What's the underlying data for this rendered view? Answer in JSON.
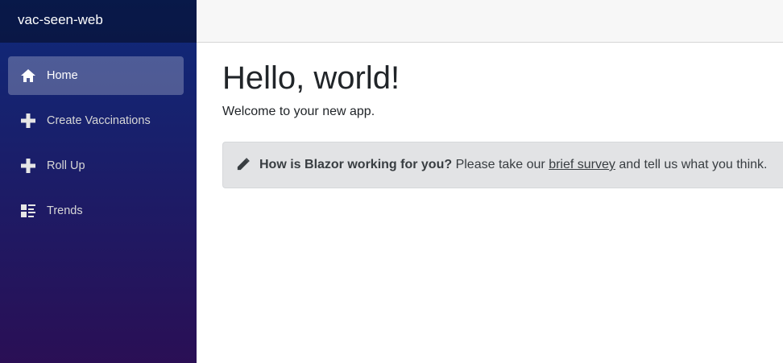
{
  "brand": {
    "title": "vac-seen-web"
  },
  "sidebar": {
    "items": [
      {
        "label": "Home",
        "icon": "home-icon",
        "active": true
      },
      {
        "label": "Create Vaccinations",
        "icon": "plus-icon",
        "active": false
      },
      {
        "label": "Roll Up",
        "icon": "plus-icon",
        "active": false
      },
      {
        "label": "Trends",
        "icon": "list-rich-icon",
        "active": false
      }
    ]
  },
  "main": {
    "title": "Hello, world!",
    "welcome": "Welcome to your new app.",
    "survey": {
      "icon": "pencil-icon",
      "question": "How is Blazor working for you?",
      "text_before": " Please take our ",
      "link_text": "brief survey",
      "text_after": " and tell us what you think."
    }
  },
  "colors": {
    "sidebar_top": "#0e2a7a",
    "sidebar_bottom": "#2a0f55",
    "alert_bg": "#e2e3e5",
    "top_row_bg": "#f7f7f7"
  }
}
